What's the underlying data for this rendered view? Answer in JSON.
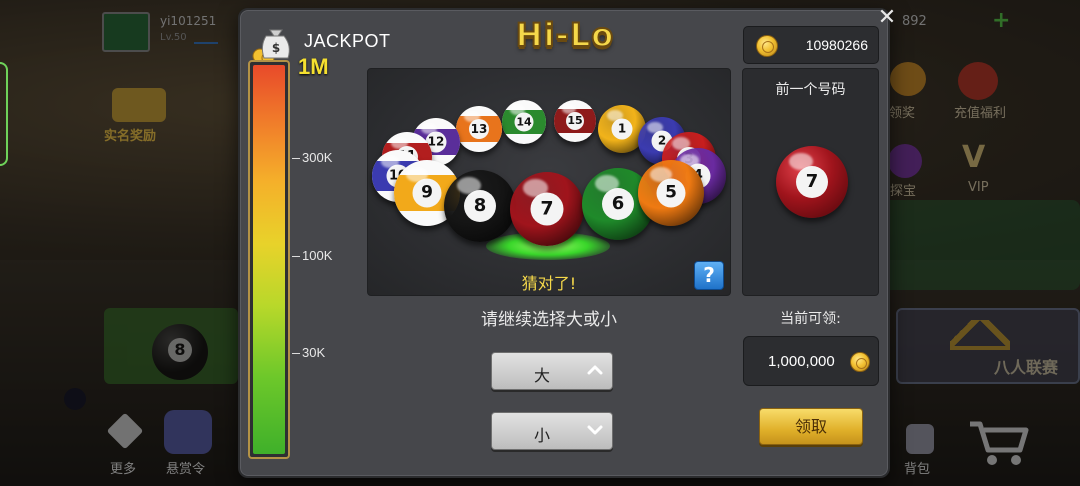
{
  "background": {
    "player_name": "yi101251",
    "player_level": "Lv.50",
    "currency_partial": "892",
    "plus_symbol": "+",
    "left_promo": "实名奖励",
    "right_item_1": "运领奖",
    "right_item_2": "充值福利",
    "right_item_3": "探宝",
    "right_item_4": "VIP",
    "bottom_more": "更多",
    "bottom_reward": "悬赏令",
    "bottom_bag": "背包",
    "tournament": "八人联赛",
    "eight_ball": "8"
  },
  "dialog": {
    "title": "Hi-Lo",
    "close_symbol": "✕",
    "jackpot": {
      "label": "JACKPOT",
      "max_label": "1M",
      "fill_fraction": 1.0,
      "ticks": [
        {
          "label": "300K",
          "fraction": 0.76
        },
        {
          "label": "100K",
          "fraction": 0.51
        },
        {
          "label": "30K",
          "fraction": 0.26
        }
      ]
    },
    "balls_ring": [
      {
        "number": "14",
        "color": "#2b8a2e",
        "striped": true
      },
      {
        "number": "15",
        "color": "#8e1b1b",
        "striped": true
      },
      {
        "number": "13",
        "color": "#e8741c",
        "striped": true
      },
      {
        "number": "1",
        "color": "#f2b31a",
        "striped": false
      },
      {
        "number": "12",
        "color": "#5a2e9a",
        "striped": true
      },
      {
        "number": "2",
        "color": "#3b3bb0",
        "striped": false
      },
      {
        "number": "11",
        "color": "#b21e1e",
        "striped": true
      },
      {
        "number": "10",
        "color": "#3b3bb0",
        "striped": true
      },
      {
        "number": "3",
        "color": "#c81e1e",
        "striped": false
      },
      {
        "number": "4",
        "color": "#6a2aa0",
        "striped": false
      },
      {
        "number": "9",
        "color": "#f2a91a",
        "striped": true
      },
      {
        "number": "8",
        "color": "#151515",
        "striped": false
      },
      {
        "number": "7",
        "color": "#a0141c",
        "striped": false
      },
      {
        "number": "6",
        "color": "#1f8a2a",
        "striped": false
      },
      {
        "number": "5",
        "color": "#ef7a12",
        "striped": false
      }
    ],
    "result_text": "猜对了!",
    "help_symbol": "?",
    "prompt": "请继续选择大或小",
    "high_label": "大",
    "low_label": "小",
    "coins": "10980266",
    "previous_label": "前一个号码",
    "previous_number": "7",
    "claimable_label": "当前可领:",
    "claimable_value": "1,000,000",
    "claim_button": "领取"
  }
}
